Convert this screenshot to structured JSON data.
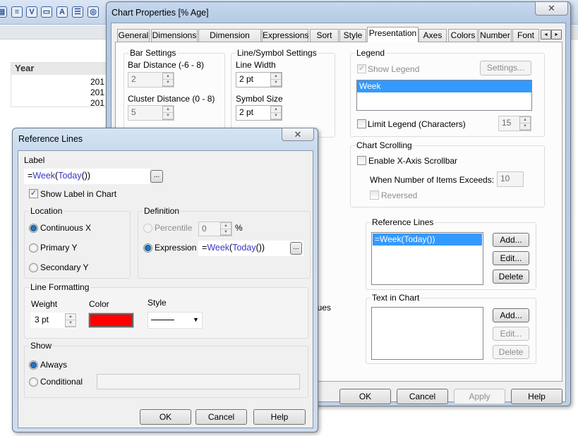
{
  "background": {
    "toolbar_icons": [
      "list-icon",
      "equals-icon",
      "checkmark-icon",
      "button-icon",
      "text-icon",
      "lines-icon",
      "image-icon"
    ],
    "toolbar_glyphs": [
      "▤",
      "≡",
      "V",
      "▭",
      "A",
      "☰",
      "◎"
    ],
    "listbox": {
      "header": "Year",
      "values": [
        "201",
        "201",
        "201"
      ]
    },
    "partial_text": "lues"
  },
  "chart_props": {
    "title": "Chart Properties [% Age]",
    "close": "✕",
    "tabs": [
      "General",
      "Dimensions",
      "Dimension Limits",
      "Expressions",
      "Sort",
      "Style",
      "Presentation",
      "Axes",
      "Colors",
      "Number",
      "Font"
    ],
    "active_tab": "Presentation",
    "tab_scroll": [
      "◂",
      "▸"
    ],
    "bar_settings": {
      "legend": "Bar Settings",
      "bar_distance_label": "Bar Distance (-6 - 8)",
      "bar_distance": "2",
      "cluster_distance_label": "Cluster Distance (0 - 8)",
      "cluster_distance": "5"
    },
    "line_symbol": {
      "legend": "Line/Symbol Settings",
      "line_width_label": "Line Width",
      "line_width": "2 pt",
      "symbol_size_label": "Symbol Size",
      "symbol_size": "2 pt"
    },
    "legend": {
      "legend": "Legend",
      "show_legend": "Show Legend",
      "show_legend_checked": true,
      "settings": "Settings...",
      "items": [
        "Week"
      ],
      "limit_legend": "Limit Legend (Characters)",
      "limit_value": "15"
    },
    "scrolling": {
      "legend": "Chart Scrolling",
      "enable": "Enable X-Axis Scrollbar",
      "exceeds_label": "When Number of Items Exceeds:",
      "exceeds_value": "10",
      "reversed": "Reversed"
    },
    "reference_lines": {
      "legend": "Reference Lines",
      "items": [
        "=Week(Today())"
      ],
      "add": "Add...",
      "edit": "Edit...",
      "delete": "Delete"
    },
    "text_in_chart": {
      "legend": "Text in Chart",
      "add": "Add...",
      "edit": "Edit...",
      "delete": "Delete"
    },
    "buttons": {
      "ok": "OK",
      "cancel": "Cancel",
      "apply": "Apply",
      "help": "Help"
    }
  },
  "ref_dialog": {
    "title": "Reference Lines",
    "close": "✕",
    "label_heading": "Label",
    "label_expr": {
      "p1": "=",
      "p2": "Week",
      "p3": "(",
      "p4": "Today",
      "p5": "())"
    },
    "ellipsis": "...",
    "show_label": "Show Label in Chart",
    "show_label_checked": true,
    "location": {
      "legend": "Location",
      "options": [
        "Continuous X",
        "Primary Y",
        "Secondary Y"
      ],
      "selected": "Continuous X"
    },
    "definition": {
      "legend": "Definition",
      "percentile": "Percentile",
      "percentile_value": "0",
      "percent_sign": "%",
      "expression": "Expression",
      "selected": "Expression"
    },
    "line_formatting": {
      "legend": "Line Formatting",
      "weight_label": "Weight",
      "weight": "3 pt",
      "color_label": "Color",
      "color": "#ff0000",
      "style_label": "Style",
      "style": "solid"
    },
    "show": {
      "legend": "Show",
      "options": [
        "Always",
        "Conditional"
      ],
      "selected": "Always"
    },
    "buttons": {
      "ok": "OK",
      "cancel": "Cancel",
      "help": "Help"
    }
  }
}
